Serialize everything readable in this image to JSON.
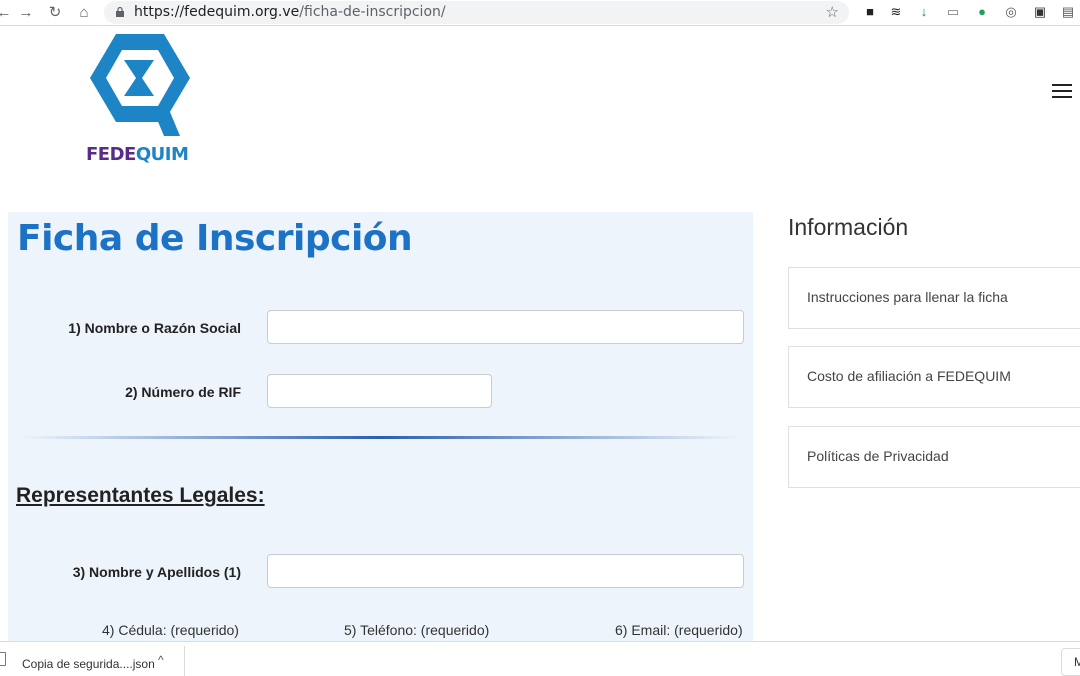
{
  "browser": {
    "url_host": "https://fedequim.org.ve",
    "url_path": "/ficha-de-inscripcion/"
  },
  "site": {
    "logo_text_a": "FEDE",
    "logo_text_b": "QUIM",
    "brand_blue": "#1d84c6",
    "brand_purple": "#5a2c8a"
  },
  "form": {
    "title": "Ficha de Inscripción",
    "fields": [
      {
        "label": "1) Nombre o Razón Social",
        "value": ""
      },
      {
        "label": "2) Número de RIF",
        "value": ""
      },
      {
        "label": "3) Nombre y Apellidos (1)",
        "value": ""
      }
    ],
    "section_heading": "Representantes Legales:",
    "sub_labels": [
      "4) Cédula: (requerido)",
      "5) Teléfono: (requerido)",
      "6) Email: (requerido)"
    ]
  },
  "sidebar": {
    "title": "Información",
    "items": [
      "Instrucciones para llenar la ficha",
      "Costo de afiliación a FEDEQUIM",
      "Políticas de Privacidad"
    ]
  },
  "download_bar": {
    "file_name": "Copia de segurida....json",
    "more_button": "M"
  }
}
